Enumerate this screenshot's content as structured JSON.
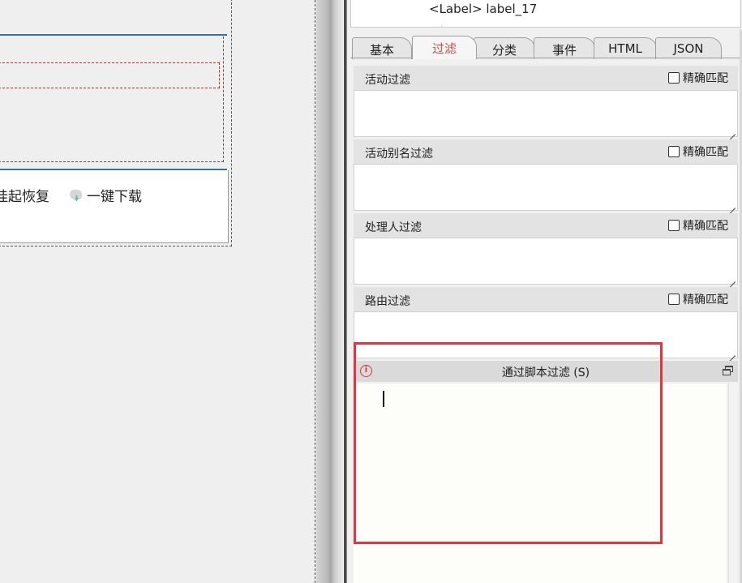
{
  "canvas": {
    "toolbar": {
      "suspend_resume_label": "挂起恢复",
      "download_label": "一键下载",
      "download_icon": "download-icon"
    }
  },
  "tree": {
    "node_text": "<Label> label_17"
  },
  "tabs": [
    {
      "label": "基本",
      "active": false
    },
    {
      "label": "过滤",
      "active": true
    },
    {
      "label": "分类",
      "active": false
    },
    {
      "label": "事件",
      "active": false
    },
    {
      "label": "HTML",
      "active": false
    },
    {
      "label": "JSON",
      "active": false
    }
  ],
  "filters": [
    {
      "label": "活动过滤",
      "exact_label": "精确匹配",
      "exact_checked": false,
      "value": ""
    },
    {
      "label": "活动别名过滤",
      "exact_label": "精确匹配",
      "exact_checked": false,
      "value": ""
    },
    {
      "label": "处理人过滤",
      "exact_label": "精确匹配",
      "exact_checked": false,
      "value": ""
    },
    {
      "label": "路由过滤",
      "exact_label": "精确匹配",
      "exact_checked": false,
      "value": ""
    }
  ],
  "script": {
    "title": "通过脚本过滤 (S)",
    "value": "",
    "info_icon": "info-icon",
    "restore_icon": "restore-window-icon"
  },
  "colors": {
    "active_tab_text": "#c0504d",
    "highlight_border": "#e0363f",
    "blue_rule": "#3d6fa3"
  }
}
